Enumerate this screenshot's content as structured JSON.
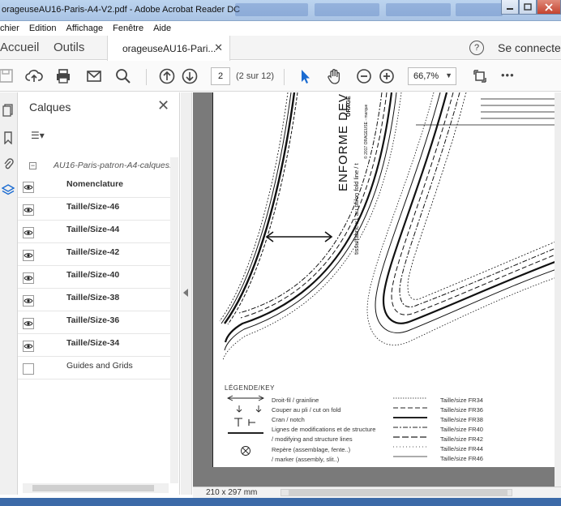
{
  "window": {
    "title": "orageuseAU16-Paris-A4-V2.pdf - Adobe Acrobat Reader DC",
    "controls": [
      "minimize",
      "maximize",
      "close"
    ]
  },
  "menu": {
    "items": [
      "chier",
      "Edition",
      "Affichage",
      "Fenêtre",
      "Aide"
    ]
  },
  "tabs": {
    "home": "Accueil",
    "tools": "Outils",
    "doc_tab": "orageuseAU16-Pari...",
    "help": "?",
    "connect": "Se connecter"
  },
  "toolbar": {
    "page_current": "2",
    "page_of": "(2 sur 12)",
    "zoom": "66,7%",
    "more": "•••"
  },
  "panel": {
    "title": "Calques",
    "root_layer": "AU16-Paris-patron-A4-calques.",
    "layers": [
      {
        "label": "Nomenclature",
        "visible": true
      },
      {
        "label": "Taille/Size-46",
        "visible": true
      },
      {
        "label": "Taille/Size-44",
        "visible": true
      },
      {
        "label": "Taille/Size-42",
        "visible": true
      },
      {
        "label": "Taille/Size-40",
        "visible": true
      },
      {
        "label": "Taille/Size-38",
        "visible": true
      },
      {
        "label": "Taille/Size-36",
        "visible": true
      },
      {
        "label": "Taille/Size-34",
        "visible": true
      },
      {
        "label": "Guides and Grids",
        "visible": false
      }
    ]
  },
  "document": {
    "vertical_brand": "ORAGE",
    "vertical_title": "ENFORME DEV",
    "vertical_sub": "tissu/fabric x1 au pli/on fold line / t",
    "vertical_copy": "© 2017 ORAGEUSE - marque",
    "legend_title": "LÉGENDE/KEY",
    "legend_items": [
      "Droit-fil / grainline",
      "Couper au pli / cut on fold",
      "Cran / notch",
      "Lignes de modifications et de structure",
      "/ modifying and structure lines",
      "Repère (assemblage, fente..)",
      "/ marker (assembly, slit..)"
    ],
    "sizes": [
      "Taille/size FR34",
      "Taille/size FR36",
      "Taille/size FR38",
      "Taille/size FR40",
      "Taille/size FR42",
      "Taille/size FR44",
      "Taille/size FR46"
    ]
  },
  "status": {
    "page_size": "210 x 297 mm"
  }
}
